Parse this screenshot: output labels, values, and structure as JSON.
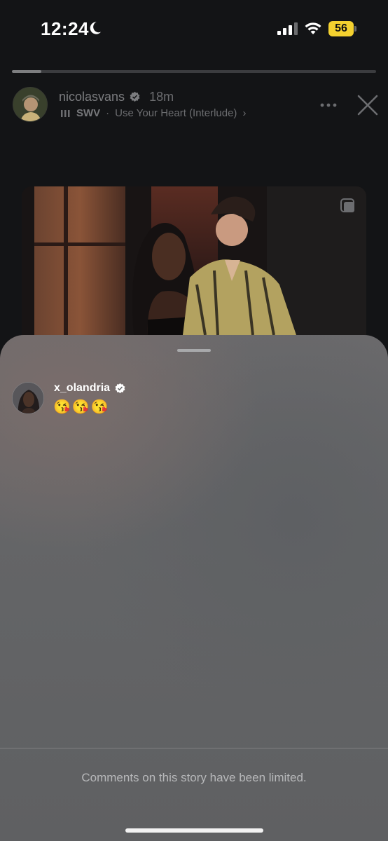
{
  "status_bar": {
    "time": "12:24",
    "battery_level": "56",
    "icons": [
      "moon-icon",
      "signal-icon",
      "wifi-icon",
      "battery-icon"
    ]
  },
  "story": {
    "progress_fraction": 0.08,
    "username": "nicolasvans",
    "verified": true,
    "time_ago": "18m",
    "music": {
      "artist": "SWV",
      "separator": "·",
      "track": "Use Your Heart (Interlude)",
      "chevron": "›"
    },
    "actions": [
      "more-icon",
      "close-icon"
    ]
  },
  "comments_sheet": {
    "comments": [
      {
        "username": "x_olandria",
        "verified": true,
        "text": "😘😘😘"
      }
    ],
    "limited_notice": "Comments on this story have been limited."
  },
  "colors": {
    "background": "#131416",
    "battery": "#f4d12f",
    "sheet": "#646567",
    "verified": "#ffffff"
  }
}
